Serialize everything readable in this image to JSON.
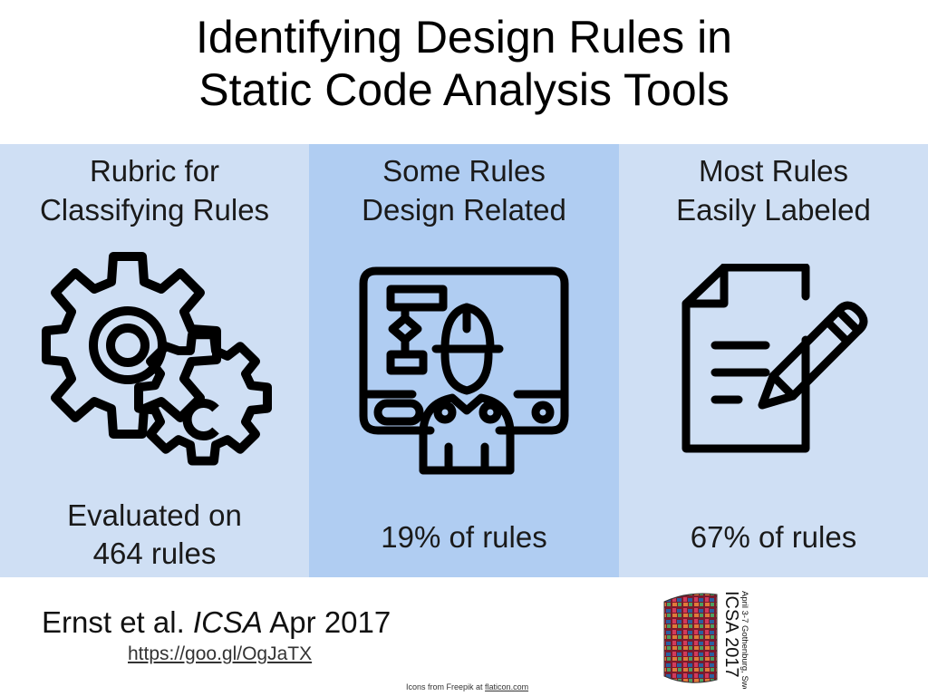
{
  "title": {
    "line1": "Identifying Design Rules in",
    "line2": "Static Code Analysis Tools"
  },
  "panels": [
    {
      "head_line1": "Rubric for",
      "head_line2": "Classifying Rules",
      "icon": "gears-icon",
      "foot_line1": "Evaluated on",
      "foot_line2": "464 rules",
      "bg": "#cfdff4"
    },
    {
      "head_line1": "Some Rules",
      "head_line2": "Design Related",
      "icon": "engineer-monitor-icon",
      "foot_line1": "19% of rules",
      "bg": "#b0cdf2"
    },
    {
      "head_line1": "Most Rules",
      "head_line2": "Easily Labeled",
      "icon": "document-pencil-icon",
      "foot_line1": "67% of rules",
      "bg": "#cfdff4"
    }
  ],
  "citation": {
    "authors": "Ernst et al.",
    "venue": "ICSA",
    "date": "Apr 2017",
    "link": "https://goo.gl/OgJaTX"
  },
  "credit": {
    "prefix": "Icons from Freepik at",
    "site": "flaticon.com"
  },
  "logo": {
    "text": "ICSA 2017",
    "subtext": "April 3-7 Gothenburg, Sweden"
  }
}
